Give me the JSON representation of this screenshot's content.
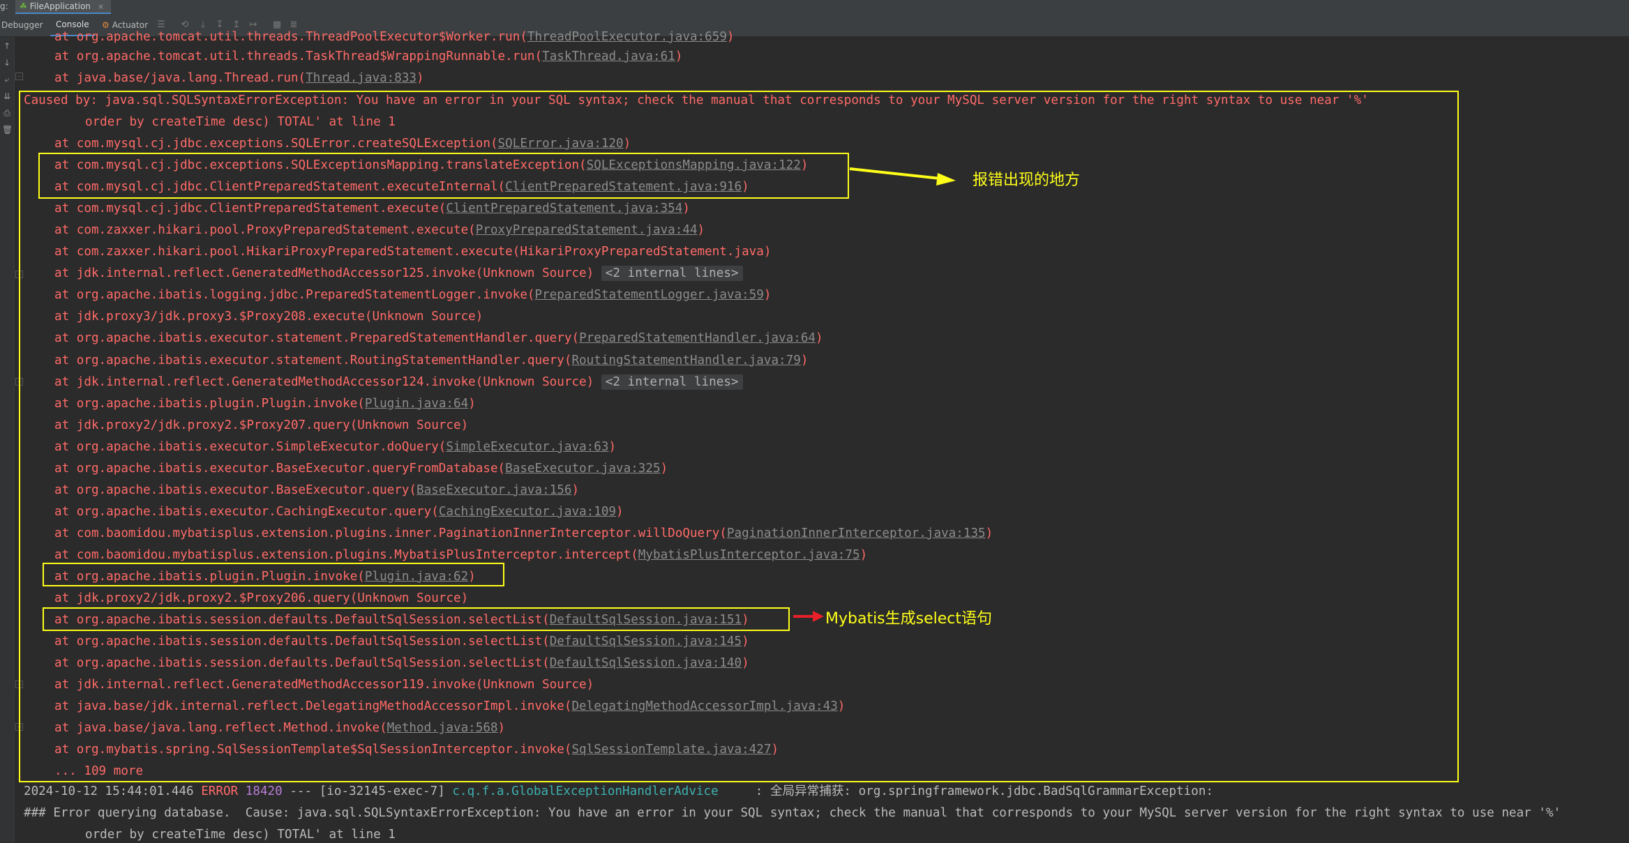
{
  "tabs": {
    "run_label": "g:",
    "run_config": "FileApplication",
    "close": "×"
  },
  "toolbar": {
    "debugger": "Debugger",
    "console": "Console",
    "actuator": "Actuator"
  },
  "icons": [
    "arrow-up-icon",
    "arrow-down-icon",
    "soft-wrap-icon",
    "scroll-end-icon",
    "print-icon",
    "trash-icon"
  ],
  "console": {
    "top_lines": [
      {
        "text": "at org.apache.tomcat.util.threads.ThreadPoolExecutor$Worker.run(",
        "link": "ThreadPoolExecutor.java:659",
        "suffix": ")"
      },
      {
        "text": "at org.apache.tomcat.util.threads.TaskThread$WrappingRunnable.run(",
        "link": "TaskThread.java:61",
        "suffix": ")"
      },
      {
        "text": "at java.base/java.lang.Thread.run(",
        "link": "Thread.java:833",
        "suffix": ")"
      }
    ],
    "caused_by": "Caused by: java.sql.SQLSyntaxErrorException: You have an error in your SQL syntax; check the manual that corresponds to your MySQL server version for the right syntax to use near '%'",
    "caused_by_cont": "order by createTime desc) TOTAL' at line 1",
    "frames": [
      {
        "text": "at com.mysql.cj.jdbc.exceptions.SQLError.createSQLException(",
        "link": "SQLError.java:120",
        "suffix": ")"
      },
      {
        "text": "at com.mysql.cj.jdbc.exceptions.SQLExceptionsMapping.translateException(",
        "link": "SQLExceptionsMapping.java:122",
        "suffix": ")"
      },
      {
        "text": "at com.mysql.cj.jdbc.ClientPreparedStatement.executeInternal(",
        "link": "ClientPreparedStatement.java:916",
        "suffix": ")"
      },
      {
        "text": "at com.mysql.cj.jdbc.ClientPreparedStatement.execute(",
        "link": "ClientPreparedStatement.java:354",
        "suffix": ")"
      },
      {
        "text": "at com.zaxxer.hikari.pool.ProxyPreparedStatement.execute(",
        "link": "ProxyPreparedStatement.java:44",
        "suffix": ")"
      },
      {
        "text": "at com.zaxxer.hikari.pool.HikariProxyPreparedStatement.execute(HikariProxyPreparedStatement.java)",
        "link": "",
        "suffix": ""
      },
      {
        "text": "at jdk.internal.reflect.GeneratedMethodAccessor125.invoke(Unknown Source) ",
        "chip": "<2 internal lines>"
      },
      {
        "text": "at org.apache.ibatis.logging.jdbc.PreparedStatementLogger.invoke(",
        "link": "PreparedStatementLogger.java:59",
        "suffix": ")"
      },
      {
        "text": "at jdk.proxy3/jdk.proxy3.$Proxy208.execute(Unknown Source)",
        "link": "",
        "suffix": ""
      },
      {
        "text": "at org.apache.ibatis.executor.statement.PreparedStatementHandler.query(",
        "link": "PreparedStatementHandler.java:64",
        "suffix": ")"
      },
      {
        "text": "at org.apache.ibatis.executor.statement.RoutingStatementHandler.query(",
        "link": "RoutingStatementHandler.java:79",
        "suffix": ")"
      },
      {
        "text": "at jdk.internal.reflect.GeneratedMethodAccessor124.invoke(Unknown Source) ",
        "chip": "<2 internal lines>"
      },
      {
        "text": "at org.apache.ibatis.plugin.Plugin.invoke(",
        "link": "Plugin.java:64",
        "suffix": ")"
      },
      {
        "text": "at jdk.proxy2/jdk.proxy2.$Proxy207.query(Unknown Source)",
        "link": "",
        "suffix": ""
      },
      {
        "text": "at org.apache.ibatis.executor.SimpleExecutor.doQuery(",
        "link": "SimpleExecutor.java:63",
        "suffix": ")"
      },
      {
        "text": "at org.apache.ibatis.executor.BaseExecutor.queryFromDatabase(",
        "link": "BaseExecutor.java:325",
        "suffix": ")"
      },
      {
        "text": "at org.apache.ibatis.executor.BaseExecutor.query(",
        "link": "BaseExecutor.java:156",
        "suffix": ")"
      },
      {
        "text": "at org.apache.ibatis.executor.CachingExecutor.query(",
        "link": "CachingExecutor.java:109",
        "suffix": ")"
      },
      {
        "text": "at com.baomidou.mybatisplus.extension.plugins.inner.PaginationInnerInterceptor.willDoQuery(",
        "link": "PaginationInnerInterceptor.java:135",
        "suffix": ")"
      },
      {
        "text": "at com.baomidou.mybatisplus.extension.plugins.MybatisPlusInterceptor.intercept(",
        "link": "MybatisPlusInterceptor.java:75",
        "suffix": ")"
      },
      {
        "text": "at org.apache.ibatis.plugin.Plugin.invoke(",
        "link": "Plugin.java:62",
        "suffix": ")"
      },
      {
        "text": "at jdk.proxy2/jdk.proxy2.$Proxy206.query(Unknown Source)",
        "link": "",
        "suffix": ""
      },
      {
        "text": "at org.apache.ibatis.session.defaults.DefaultSqlSession.selectList(",
        "link": "DefaultSqlSession.java:151",
        "suffix": ")"
      },
      {
        "text": "at org.apache.ibatis.session.defaults.DefaultSqlSession.selectList(",
        "link": "DefaultSqlSession.java:145",
        "suffix": ")"
      },
      {
        "text": "at org.apache.ibatis.session.defaults.DefaultSqlSession.selectList(",
        "link": "DefaultSqlSession.java:140",
        "suffix": ")"
      },
      {
        "text": "at jdk.internal.reflect.GeneratedMethodAccessor119.invoke(Unknown Source)",
        "link": "",
        "suffix": ""
      },
      {
        "text": "at java.base/jdk.internal.reflect.DelegatingMethodAccessorImpl.invoke(",
        "link": "DelegatingMethodAccessorImpl.java:43",
        "suffix": ")"
      },
      {
        "text": "at java.base/java.lang.reflect.Method.invoke(",
        "link": "Method.java:568",
        "suffix": ")"
      },
      {
        "text": "at org.mybatis.spring.SqlSessionTemplate$SqlSessionInterceptor.invoke(",
        "link": "SqlSessionTemplate.java:427",
        "suffix": ")"
      },
      {
        "text": "... 109 more",
        "link": "",
        "suffix": ""
      }
    ],
    "log": {
      "date": "2024-10-12 15:44:01.446",
      "level": "ERROR",
      "pid": "18420",
      "thread": "--- [io-32145-exec-7]",
      "logger": "c.q.f.a.GlobalExceptionHandlerAdvice",
      "message": ": 全局异常捕获: org.springframework.jdbc.BadSqlGrammarException:"
    },
    "error_line": "### Error querying database.  Cause: java.sql.SQLSyntaxErrorException: You have an error in your SQL syntax; check the manual that corresponds to your MySQL server version for the right syntax to use near '%'",
    "error_line_cont": "order by createTime desc) TOTAL' at line 1"
  },
  "annotations": {
    "error_location": "报错出现的地方",
    "mybatis_select": "Mybatis生成select语句",
    "highlight_color": "#ffff1a",
    "red_arrow_color": "#e8202a"
  }
}
